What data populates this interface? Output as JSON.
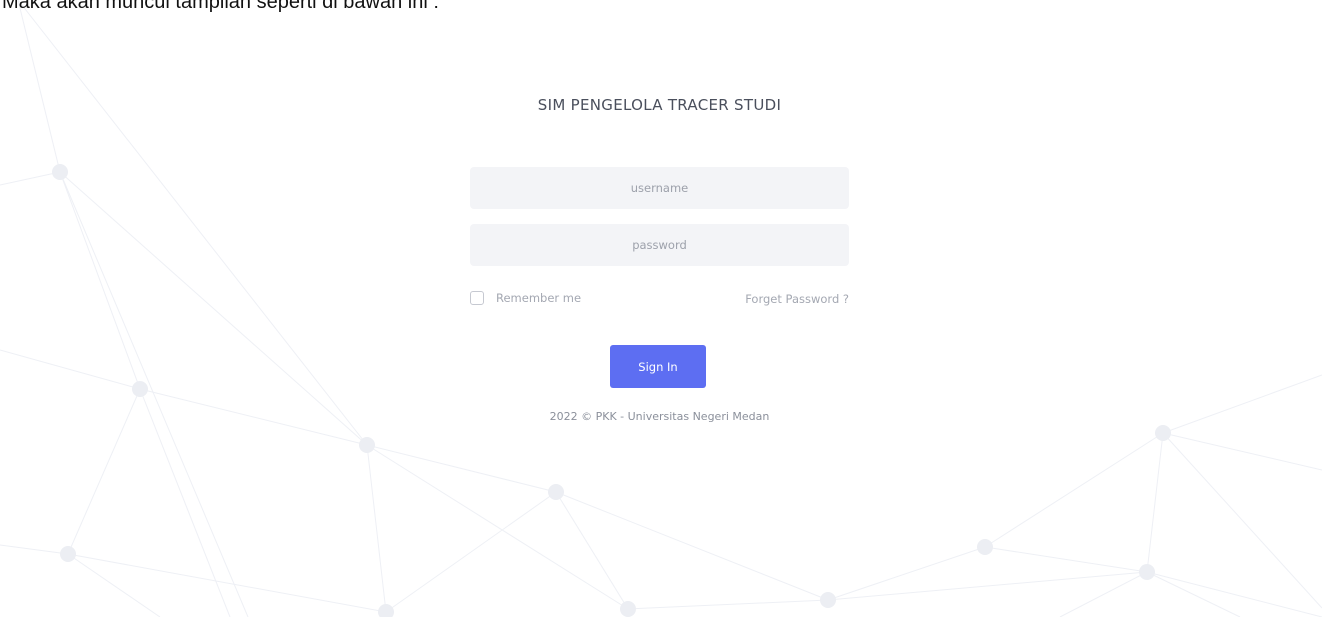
{
  "page": {
    "caption": "Maka akan muncul tampilan seperti di bawah ini :"
  },
  "login": {
    "title": "SIM PENGELOLA TRACER STUDI",
    "username_placeholder": "username",
    "password_placeholder": "password",
    "remember_label": "Remember me",
    "remember_checked": false,
    "forget_label": "Forget Password ?",
    "signin_label": "Sign In",
    "footer": "2022 © PKK - Universitas Negeri Medan"
  },
  "colors": {
    "accent": "#5d6ef2",
    "input_background": "#f3f4f7",
    "title_text": "#4a4f5c",
    "muted_text": "#a4a8b2",
    "background_network": "#eef0f5"
  }
}
